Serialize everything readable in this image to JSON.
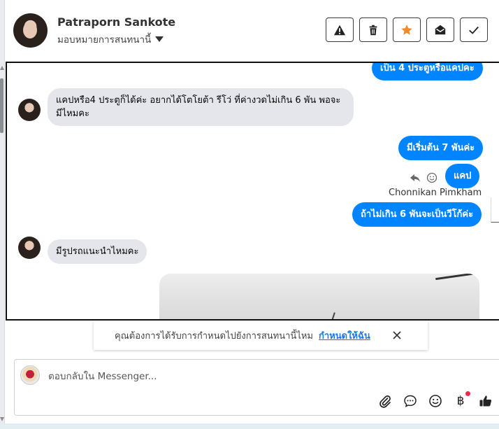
{
  "header": {
    "contact_name": "Patraporn Sankote",
    "assign_label": "มอบหมายการสนทนานี้",
    "actions": [
      {
        "name": "report",
        "icon": "warning-icon"
      },
      {
        "name": "delete",
        "icon": "trash-icon"
      },
      {
        "name": "star",
        "icon": "star-icon",
        "color": "#f28c28"
      },
      {
        "name": "mark-unread",
        "icon": "envelope-open-icon"
      },
      {
        "name": "done",
        "icon": "check-icon"
      }
    ]
  },
  "messages": {
    "m0": "เป็น 4 ประตูหรือแคปคะ",
    "m1": "แคปหรือ4 ประตูก็ได้ค่ะ อยากได้โตโยต้า รีโว่ ที่ค่างวดไม่เกิน 6 พัน พอจะมีไหมคะ",
    "m2": "มีเริ่มต้น 7 พันค่ะ",
    "m3": "แคป",
    "sender": "Chonnikan Pimkham",
    "m4": "ถ้าไม่เกิน 6 พันจะเป็นวีโก้ค่ะ",
    "m5": "มีรูปรถแนะนำไหมคะ"
  },
  "banner": {
    "text": "คุณต้องการได้รับการกำหนดไปยังการสนทนานี้ไหม",
    "link": "กำหนดให้ฉัน"
  },
  "composer": {
    "placeholder": "ตอบกลับใน Messenger..."
  },
  "colors": {
    "outgoing": "#0084ff",
    "incoming": "#e4e6eb",
    "link": "#1877f2",
    "star": "#f28c28"
  }
}
